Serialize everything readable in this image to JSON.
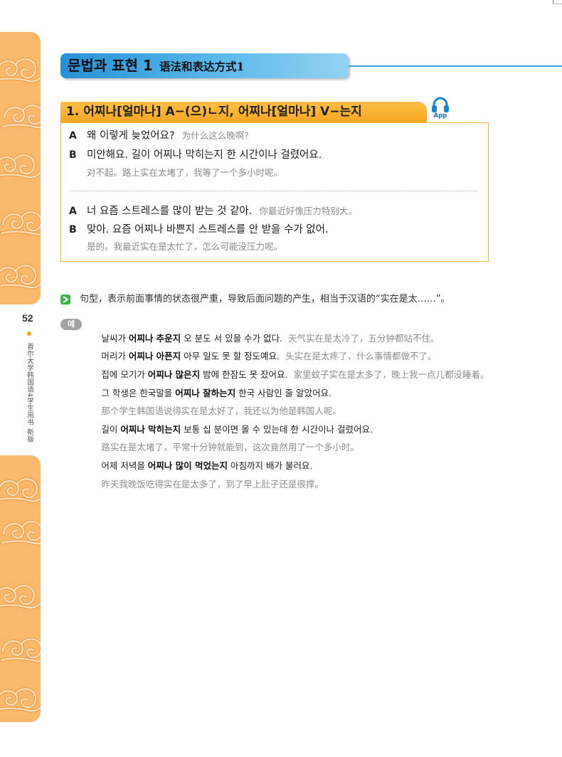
{
  "header": {
    "title_ko": "문법과 표현 1",
    "title_zh": "语法和表达方式1"
  },
  "grammar_point": {
    "title": "1. 어찌나[얼마나] A−(으)ㄴ지, 어찌나[얼마나] V−는지",
    "app_label": "App",
    "app_icon": "headphones-icon"
  },
  "dialogue": {
    "lines": [
      {
        "speaker": "A",
        "ko": "왜 이렇게 늦었어요?",
        "zh": "为什么这么晚啊?"
      },
      {
        "speaker": "B",
        "ko": "미안해요. 길이 어찌나 막히는지 한 시간이나 걸렸어요.",
        "zh": "对不起。路上实在太堵了，我等了一个多小时呢。"
      },
      {
        "speaker": "A",
        "ko": "너 요즘 스트레스를 많이 받는 것 같아.",
        "zh": "你最近好像压力特别大。"
      },
      {
        "speaker": "B",
        "ko": "맞아. 요즘 어찌나 바쁜지 스트레스를 안 받을 수가 없어.",
        "zh": "是的。我最近实在是太忙了，怎么可能没压力呢。"
      }
    ]
  },
  "explanation": {
    "icon": "green-arrow-icon",
    "text": "句型，表示前面事情的状态很严重，导致后面问题的产生，相当于汉语的“实在是太……”。"
  },
  "examples": {
    "badge": "예",
    "items": [
      {
        "ko_pre": "날씨가 ",
        "ko_bold": "어찌나 추운지",
        "ko_post": " 오 분도 서 있을 수가 없다.",
        "zh": "天气实在是太冷了，五分钟都站不住。"
      },
      {
        "ko_pre": "머리가 ",
        "ko_bold": "어찌나 아픈지",
        "ko_post": " 아무 일도 못 할 정도예요.",
        "zh": "头实在是太疼了，什么事情都做不了。"
      },
      {
        "ko_pre": "집에 모기가 ",
        "ko_bold": "어찌나 많은지",
        "ko_post": " 밤에 한잠도 못 잤어요.",
        "zh": "家里蚊子实在是太多了，晚上我一点儿都没睡着。"
      },
      {
        "ko_pre": "그 학생은 한국말을 ",
        "ko_bold": "어찌나 잘하는지",
        "ko_post": " 한국 사람인 줄 알았어요.",
        "zh": "那个学生韩国语说得实在是太好了，我还以为他是韩国人呢。"
      },
      {
        "ko_pre": "길이 ",
        "ko_bold": "어찌나 막히는지",
        "ko_post": " 보통 십 분이면 올 수 있는데 한 시간이나 걸렸어요.",
        "zh": "路实在是太堵了，平常十分钟就能到，这次竟然用了一个多小时。"
      },
      {
        "ko_pre": "어제 저녁을 ",
        "ko_bold": "어찌나 많이 먹었는지",
        "ko_post": " 아침까지 배가 불러요.",
        "zh": "昨天我晚饭吃得实在是太多了，到了早上肚子还是很撑。"
      }
    ]
  },
  "sidebar": {
    "page_number": "52",
    "book_title": "首尔大学韩国语4学生用书 新版"
  },
  "colors": {
    "accent_orange": "#f7a621",
    "accent_blue": "#2591d6",
    "explanation_green": "#3bb34a",
    "side_strip": "#f8b96c"
  }
}
